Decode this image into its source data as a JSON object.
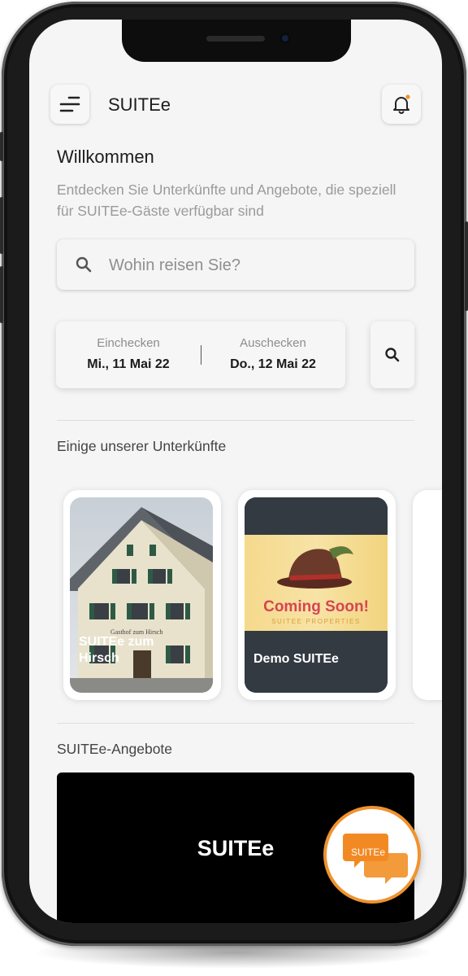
{
  "header": {
    "title": "SUITEe",
    "menu_icon": "menu-icon",
    "notification_icon": "bell-icon",
    "notification_badge_color": "#f0922e"
  },
  "welcome": {
    "title": "Willkommen",
    "subtitle": "Entdecken Sie Unterkünfte und Angebote, die speziell für SUITEe-Gäste verfügbar sind"
  },
  "search": {
    "placeholder": "Wohin reisen Sie?",
    "icon": "search-icon"
  },
  "dates": {
    "checkin_label": "Einchecken",
    "checkin_value": "Mi., 11 Mai 22",
    "checkout_label": "Auschecken",
    "checkout_value": "Do., 12 Mai 22",
    "search_icon": "search-icon"
  },
  "properties": {
    "section_title": "Einige unserer Unterkünfte",
    "items": [
      {
        "name": "SUITEe zum Hirsch",
        "sign_text": "Gasthof zum Hirsch"
      },
      {
        "name": "Demo SUITEe",
        "coming_soon": "Coming Soon!",
        "tagline": "SUITEE PROPERTIES"
      }
    ]
  },
  "offers": {
    "section_title": "SUITEe-Angebote",
    "banner_text": "SUITEe"
  },
  "chat": {
    "label": "SUITEe",
    "accent_color": "#f0922e"
  }
}
